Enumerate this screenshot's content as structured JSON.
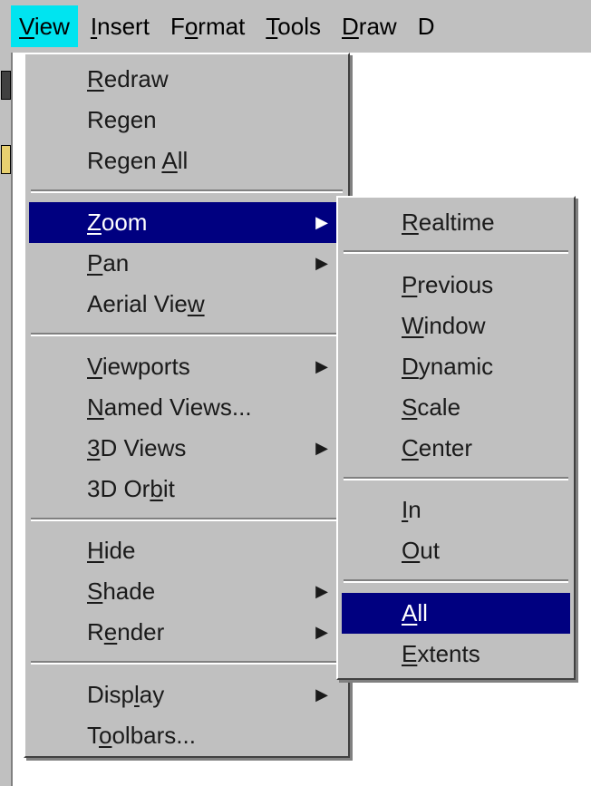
{
  "menubar": {
    "items": [
      {
        "label": "View",
        "mnemonic": "V"
      },
      {
        "label": "Insert",
        "mnemonic": "I"
      },
      {
        "label": "Format",
        "mnemonic": "o"
      },
      {
        "label": "Tools",
        "mnemonic": "T"
      },
      {
        "label": "Draw",
        "mnemonic": "D"
      },
      {
        "label": "D",
        "mnemonic": ""
      }
    ]
  },
  "view_menu": {
    "items": [
      {
        "label": "Redraw",
        "mnemonic": "R"
      },
      {
        "label": "Regen",
        "mnemonic": ""
      },
      {
        "label": "Regen All",
        "mnemonic": "A"
      },
      {
        "label": "Zoom",
        "mnemonic": "Z",
        "submenu_arrow": "▶"
      },
      {
        "label": "Pan",
        "mnemonic": "P",
        "submenu_arrow": "▶"
      },
      {
        "label": "Aerial View",
        "mnemonic": "w"
      },
      {
        "label": "Viewports",
        "mnemonic": "V",
        "submenu_arrow": "▶"
      },
      {
        "label": "Named Views...",
        "mnemonic": "N"
      },
      {
        "label": "3D Views",
        "mnemonic": "3",
        "submenu_arrow": "▶"
      },
      {
        "label": "3D Orbit",
        "mnemonic": "b"
      },
      {
        "label": "Hide",
        "mnemonic": "H"
      },
      {
        "label": "Shade",
        "mnemonic": "S",
        "submenu_arrow": "▶"
      },
      {
        "label": "Render",
        "mnemonic": "e",
        "submenu_arrow": "▶"
      },
      {
        "label": "Display",
        "mnemonic": "l",
        "submenu_arrow": "▶"
      },
      {
        "label": "Toolbars...",
        "mnemonic": "o"
      }
    ]
  },
  "zoom_menu": {
    "items": [
      {
        "label": "Realtime",
        "mnemonic": "R"
      },
      {
        "label": "Previous",
        "mnemonic": "P"
      },
      {
        "label": "Window",
        "mnemonic": "W"
      },
      {
        "label": "Dynamic",
        "mnemonic": "D"
      },
      {
        "label": "Scale",
        "mnemonic": "S"
      },
      {
        "label": "Center",
        "mnemonic": "C"
      },
      {
        "label": "In",
        "mnemonic": "I"
      },
      {
        "label": "Out",
        "mnemonic": "O"
      },
      {
        "label": "All",
        "mnemonic": "A"
      },
      {
        "label": "Extents",
        "mnemonic": "E"
      }
    ]
  },
  "colors": {
    "menu_bg": "#c0c0c0",
    "highlight_bg": "#000080",
    "highlight_text": "#ffffff",
    "active_menubar_bg": "#00e4f0"
  }
}
